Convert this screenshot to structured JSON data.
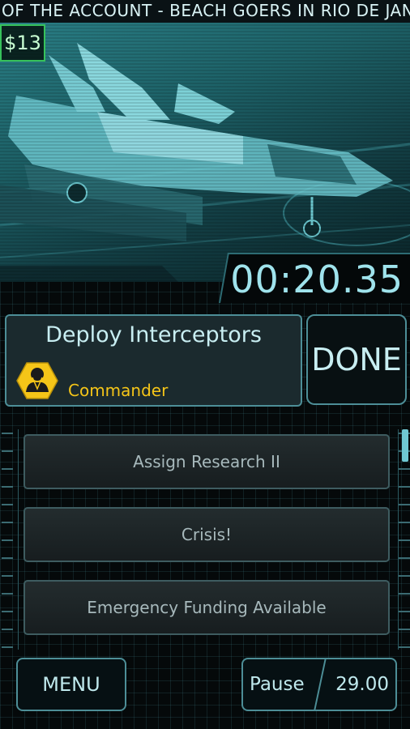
{
  "ticker": {
    "text": "OF THE ACCOUNT - BEACH GOERS IN RIO DE JAN"
  },
  "hud": {
    "money": "$13",
    "timer": "00:20.35"
  },
  "objective": {
    "title": "Deploy Interceptors",
    "rank": "Commander",
    "done_label": "DONE"
  },
  "queue": {
    "items": [
      {
        "label": "Assign Research II"
      },
      {
        "label": "Crisis!"
      },
      {
        "label": "Emergency Funding Available"
      }
    ]
  },
  "footer": {
    "menu_label": "MENU",
    "pause_label": "Pause",
    "pause_value": "29.00"
  },
  "colors": {
    "accent": "#4d8e97",
    "rank": "#f5c518",
    "money_border": "#37c25b"
  }
}
